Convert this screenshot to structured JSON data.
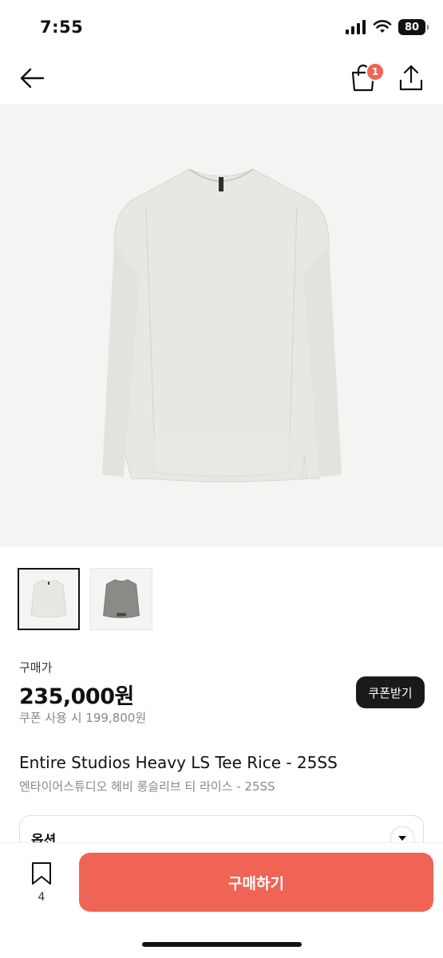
{
  "status_bar": {
    "time": "7:55",
    "battery": "80"
  },
  "nav": {
    "cart_badge": "1"
  },
  "product": {
    "buy_label": "구매가",
    "price": "235,000원",
    "coupon_price": "쿠폰 사용 시 199,800원",
    "coupon_button": "쿠폰받기",
    "title_en": "Entire Studios Heavy LS Tee Rice - 25SS",
    "title_ko": "엔타이어스튜디오 헤비 롱슬리브 티 라이스 - 25SS"
  },
  "option": {
    "label": "옵션"
  },
  "bottom": {
    "bookmark_count": "4",
    "buy_button": "구매하기"
  },
  "colors": {
    "accent": "#f06455",
    "garment_rice": "#e7e8e1",
    "garment_grey": "#8a8a86"
  }
}
